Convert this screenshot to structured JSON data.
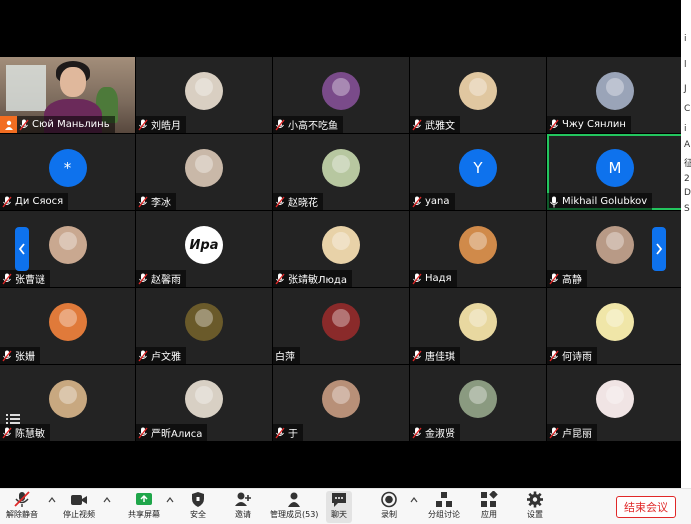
{
  "colors": {
    "accent": "#0e72ed",
    "active_speaker": "#23c55e",
    "end_button": "#e02828",
    "host": "#f26d21"
  },
  "right_strip_glyphs": [
    "i",
    "l",
    "J",
    "C",
    "i",
    "A",
    "征",
    "2",
    "D",
    "S"
  ],
  "participants": [
    {
      "name": "Сюй Маньлинь",
      "avatar": {
        "kind": "camera"
      },
      "mic": "muted",
      "host": true
    },
    {
      "name": "刘皓月",
      "avatar": {
        "kind": "photo",
        "bg": "#d9cfc2"
      },
      "mic": "muted"
    },
    {
      "name": "小高不吃鱼",
      "avatar": {
        "kind": "photo",
        "bg": "#7a4b8a"
      },
      "mic": "muted"
    },
    {
      "name": "武雅文",
      "avatar": {
        "kind": "photo",
        "bg": "#e0c7a0"
      },
      "mic": "muted"
    },
    {
      "name": "Чжу Сянлин",
      "avatar": {
        "kind": "photo",
        "bg": "#9aa4b8"
      },
      "mic": "muted"
    },
    {
      "name": "Ди Сяося",
      "avatar": {
        "kind": "letter",
        "letter": "*"
      },
      "mic": "muted"
    },
    {
      "name": "李冰",
      "avatar": {
        "kind": "photo",
        "bg": "#c9b8a8"
      },
      "mic": "muted"
    },
    {
      "name": "赵晓花",
      "avatar": {
        "kind": "photo",
        "bg": "#b7c7a0"
      },
      "mic": "muted"
    },
    {
      "name": "yana",
      "avatar": {
        "kind": "letter",
        "letter": "Y"
      },
      "mic": "muted"
    },
    {
      "name": "Mikhail Golubkov",
      "avatar": {
        "kind": "letter",
        "letter": "M"
      },
      "mic": "active",
      "speaking": true
    },
    {
      "name": "张曹谜",
      "avatar": {
        "kind": "photo",
        "bg": "#c9a890"
      },
      "mic": "muted"
    },
    {
      "name": "赵馨雨",
      "avatar": {
        "kind": "word",
        "text": "Ира"
      },
      "mic": "muted"
    },
    {
      "name": "张靖敏Люда",
      "avatar": {
        "kind": "photo",
        "bg": "#e8d2a8"
      },
      "mic": "muted"
    },
    {
      "name": "Надя",
      "avatar": {
        "kind": "photo",
        "bg": "#d08a4a"
      },
      "mic": "muted"
    },
    {
      "name": "高静",
      "avatar": {
        "kind": "photo",
        "bg": "#b89a86"
      },
      "mic": "muted"
    },
    {
      "name": "张姗",
      "avatar": {
        "kind": "photo",
        "bg": "#e07a3a"
      },
      "mic": "muted"
    },
    {
      "name": "卢文雅",
      "avatar": {
        "kind": "photo",
        "bg": "#6a5a2a"
      },
      "mic": "muted"
    },
    {
      "name": "白萍",
      "avatar": {
        "kind": "photo",
        "bg": "#8a2a2a"
      },
      "mic": "none"
    },
    {
      "name": "唐佳琪",
      "avatar": {
        "kind": "photo",
        "bg": "#e8d8a0"
      },
      "mic": "muted"
    },
    {
      "name": "何诗雨",
      "avatar": {
        "kind": "photo",
        "bg": "#f0e6a8"
      },
      "mic": "muted"
    },
    {
      "name": "陈慧敏",
      "avatar": {
        "kind": "photo",
        "bg": "#c8a880"
      },
      "mic": "muted"
    },
    {
      "name": "严昕Алиса",
      "avatar": {
        "kind": "photo",
        "bg": "#d8d0c4"
      },
      "mic": "muted"
    },
    {
      "name": "于",
      "avatar": {
        "kind": "photo",
        "bg": "#b89078"
      },
      "mic": "muted"
    },
    {
      "name": "金淑贤",
      "avatar": {
        "kind": "photo",
        "bg": "#8a9a80"
      },
      "mic": "muted"
    },
    {
      "name": "卢昆丽",
      "avatar": {
        "kind": "photo",
        "bg": "#f0e4e4"
      },
      "mic": "muted"
    }
  ],
  "toolbar": {
    "unmute": "解除静音",
    "stop_video": "停止视频",
    "share_screen": "共享屏幕",
    "security": "安全",
    "invite": "邀请",
    "participants": "管理成员(53)",
    "chat": "聊天",
    "record": "录制",
    "breakout": "分组讨论",
    "apps": "应用",
    "settings": "设置",
    "end_meeting": "结束会议"
  }
}
